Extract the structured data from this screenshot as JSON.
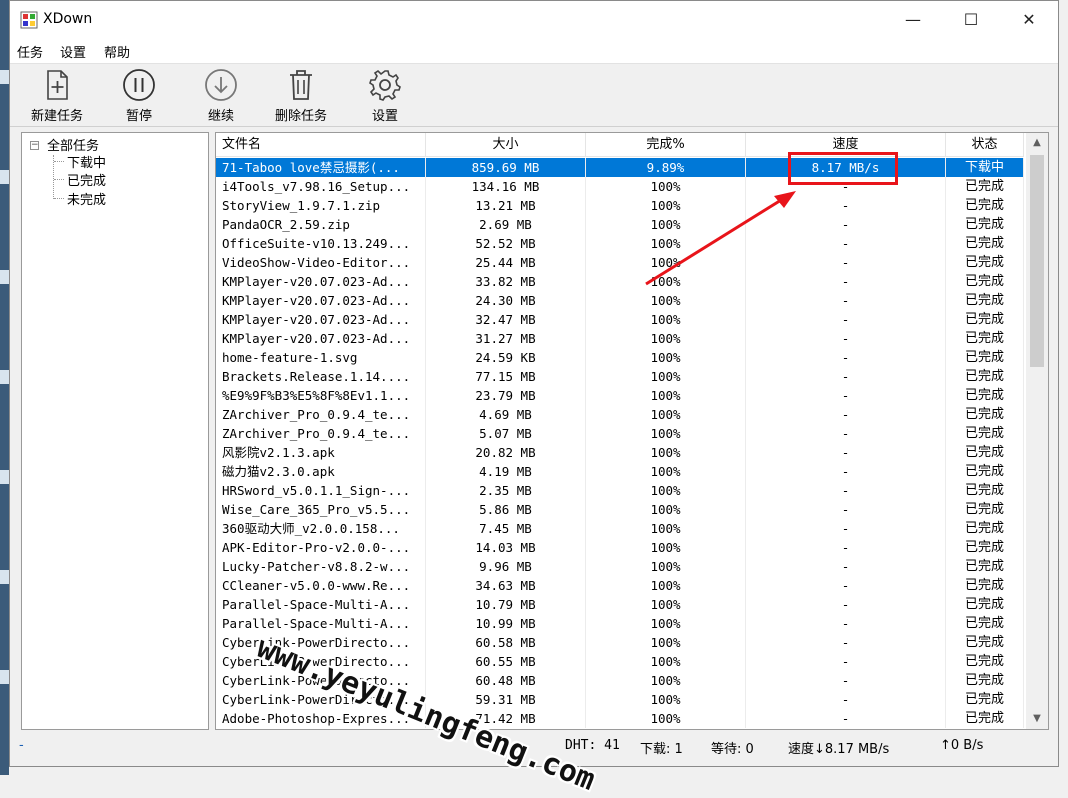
{
  "window": {
    "title": "XDown"
  },
  "menu": [
    "任务",
    "设置",
    "帮助"
  ],
  "toolbar": [
    {
      "label": "新建任务",
      "icon": "new-task-icon"
    },
    {
      "label": "暂停",
      "icon": "pause-icon"
    },
    {
      "label": "继续",
      "icon": "resume-icon"
    },
    {
      "label": "删除任务",
      "icon": "delete-icon"
    },
    {
      "label": "设置",
      "icon": "gear-icon"
    }
  ],
  "tree": {
    "root": "全部任务",
    "children": [
      "下载中",
      "已完成",
      "未完成"
    ]
  },
  "columns": [
    "文件名",
    "大小",
    "完成%",
    "速度",
    "状态"
  ],
  "rows": [
    {
      "name": "71-Taboo love禁忌摄影(...",
      "size": "859.69 MB",
      "done": "9.89%",
      "speed": "8.17 MB/s",
      "status": "下载中",
      "selected": true
    },
    {
      "name": "i4Tools_v7.98.16_Setup...",
      "size": "134.16 MB",
      "done": "100%",
      "speed": "-",
      "status": "已完成"
    },
    {
      "name": "StoryView_1.9.7.1.zip",
      "size": "13.21 MB",
      "done": "100%",
      "speed": "-",
      "status": "已完成"
    },
    {
      "name": "PandaOCR_2.59.zip",
      "size": "2.69 MB",
      "done": "100%",
      "speed": "-",
      "status": "已完成"
    },
    {
      "name": "OfficeSuite-v10.13.249...",
      "size": "52.52 MB",
      "done": "100%",
      "speed": "-",
      "status": "已完成"
    },
    {
      "name": "VideoShow-Video-Editor...",
      "size": "25.44 MB",
      "done": "100%",
      "speed": "-",
      "status": "已完成"
    },
    {
      "name": "KMPlayer-v20.07.023-Ad...",
      "size": "33.82 MB",
      "done": "100%",
      "speed": "-",
      "status": "已完成"
    },
    {
      "name": "KMPlayer-v20.07.023-Ad...",
      "size": "24.30 MB",
      "done": "100%",
      "speed": "-",
      "status": "已完成"
    },
    {
      "name": "KMPlayer-v20.07.023-Ad...",
      "size": "32.47 MB",
      "done": "100%",
      "speed": "-",
      "status": "已完成"
    },
    {
      "name": "KMPlayer-v20.07.023-Ad...",
      "size": "31.27 MB",
      "done": "100%",
      "speed": "-",
      "status": "已完成"
    },
    {
      "name": "home-feature-1.svg",
      "size": "24.59 KB",
      "done": "100%",
      "speed": "-",
      "status": "已完成"
    },
    {
      "name": "Brackets.Release.1.14....",
      "size": "77.15 MB",
      "done": "100%",
      "speed": "-",
      "status": "已完成"
    },
    {
      "name": "%E9%9F%B3%E5%8F%8Ev1.1...",
      "size": "23.79 MB",
      "done": "100%",
      "speed": "-",
      "status": "已完成"
    },
    {
      "name": "ZArchiver_Pro_0.9.4_te...",
      "size": "4.69 MB",
      "done": "100%",
      "speed": "-",
      "status": "已完成"
    },
    {
      "name": "ZArchiver_Pro_0.9.4_te...",
      "size": "5.07 MB",
      "done": "100%",
      "speed": "-",
      "status": "已完成"
    },
    {
      "name": "风影院v2.1.3.apk",
      "size": "20.82 MB",
      "done": "100%",
      "speed": "-",
      "status": "已完成"
    },
    {
      "name": "磁力猫v2.3.0.apk",
      "size": "4.19 MB",
      "done": "100%",
      "speed": "-",
      "status": "已完成"
    },
    {
      "name": "HRSword_v5.0.1.1_Sign-...",
      "size": "2.35 MB",
      "done": "100%",
      "speed": "-",
      "status": "已完成"
    },
    {
      "name": "Wise_Care_365_Pro_v5.5...",
      "size": "5.86 MB",
      "done": "100%",
      "speed": "-",
      "status": "已完成"
    },
    {
      "name": "360驱动大师_v2.0.0.158...",
      "size": "7.45 MB",
      "done": "100%",
      "speed": "-",
      "status": "已完成"
    },
    {
      "name": "APK-Editor-Pro-v2.0.0-...",
      "size": "14.03 MB",
      "done": "100%",
      "speed": "-",
      "status": "已完成"
    },
    {
      "name": "Lucky-Patcher-v8.8.2-w...",
      "size": "9.96 MB",
      "done": "100%",
      "speed": "-",
      "status": "已完成"
    },
    {
      "name": "CCleaner-v5.0.0-www.Re...",
      "size": "34.63 MB",
      "done": "100%",
      "speed": "-",
      "status": "已完成"
    },
    {
      "name": "Parallel-Space-Multi-A...",
      "size": "10.79 MB",
      "done": "100%",
      "speed": "-",
      "status": "已完成"
    },
    {
      "name": "Parallel-Space-Multi-A...",
      "size": "10.99 MB",
      "done": "100%",
      "speed": "-",
      "status": "已完成"
    },
    {
      "name": "CyberLink-PowerDirecto...",
      "size": "60.58 MB",
      "done": "100%",
      "speed": "-",
      "status": "已完成"
    },
    {
      "name": "CyberLink-PowerDirecto...",
      "size": "60.55 MB",
      "done": "100%",
      "speed": "-",
      "status": "已完成"
    },
    {
      "name": "CyberLink-PowerDirecto...",
      "size": "60.48 MB",
      "done": "100%",
      "speed": "-",
      "status": "已完成"
    },
    {
      "name": "CyberLink-PowerDirecto...",
      "size": "59.31 MB",
      "done": "100%",
      "speed": "-",
      "status": "已完成"
    },
    {
      "name": "Adobe-Photoshop-Expres...",
      "size": "71.42 MB",
      "done": "100%",
      "speed": "-",
      "status": "已完成"
    }
  ],
  "status": {
    "left": "-",
    "dht": "DHT: 41",
    "downloading": "下载: 1",
    "waiting": "等待: 0",
    "speed": "速度↓8.17 MB/s",
    "upload": "↑0 B/s"
  },
  "watermark": "www.yeyulingfeng.com",
  "colors": {
    "selection": "#0078d7",
    "annotation": "#e8141a"
  }
}
